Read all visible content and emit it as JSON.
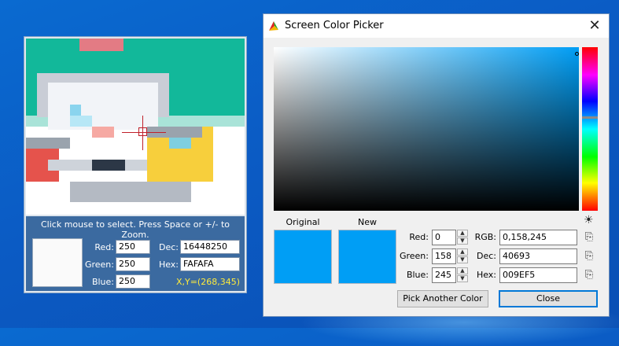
{
  "magnifier": {
    "hint": "Click mouse to select. Press Space or +/- to Zoom.",
    "red_label": "Red:",
    "red_value": "250",
    "green_label": "Green:",
    "green_value": "250",
    "blue_label": "Blue:",
    "blue_value": "250",
    "dec_label": "Dec:",
    "dec_value": "16448250",
    "hex_label": "Hex:",
    "hex_value": "FAFAFA",
    "xy_text": "X,Y=(268,345)",
    "swatch_color": "#FAFAFA",
    "crosshair_color": "#C0202A"
  },
  "dialog": {
    "title": "Screen Color Picker",
    "close_icon": "close-icon",
    "original_label": "Original",
    "new_label": "New",
    "original_color": "#009EF5",
    "new_color": "#009EF5",
    "red_label": "Red:",
    "red_value": "0",
    "green_label": "Green:",
    "green_value": "158",
    "blue_label": "Blue:",
    "blue_value": "245",
    "rgb_label": "RGB:",
    "rgb_value": "0,158,245",
    "dec_label": "Dec:",
    "dec_value": "40693",
    "hex_label": "Hex:",
    "hex_value": "009EF5",
    "pick_button": "Pick Another Color",
    "close_button": "Close",
    "accent_color": "#0078D7"
  }
}
